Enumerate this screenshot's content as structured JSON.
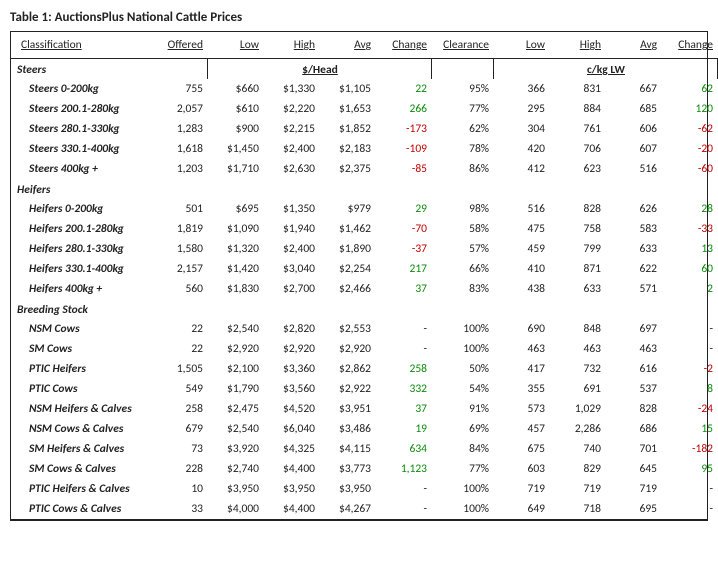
{
  "title_prefix": "Table 1:",
  "title_text": "AuctionsPlus National Cattle Prices",
  "headers": {
    "classification": "Classification",
    "offered": "Offered",
    "low": "Low",
    "high": "High",
    "avg": "Avg",
    "change": "Change",
    "clearance": "Clearance"
  },
  "units": {
    "per_head": "$/Head",
    "per_kg": "c/kg LW"
  },
  "sections": [
    {
      "name": "Steers",
      "show_units": true,
      "rows": [
        {
          "label": "Steers 0-200kg",
          "offered": "755",
          "h_low": "$660",
          "h_high": "$1,330",
          "h_avg": "$1,105",
          "h_chg": "22",
          "h_chg_sign": "pos",
          "clearance": "95%",
          "k_low": "366",
          "k_high": "831",
          "k_avg": "667",
          "k_chg": "62",
          "k_chg_sign": "pos"
        },
        {
          "label": "Steers 200.1-280kg",
          "offered": "2,057",
          "h_low": "$610",
          "h_high": "$2,220",
          "h_avg": "$1,653",
          "h_chg": "266",
          "h_chg_sign": "pos",
          "clearance": "77%",
          "k_low": "295",
          "k_high": "884",
          "k_avg": "685",
          "k_chg": "120",
          "k_chg_sign": "pos"
        },
        {
          "label": "Steers 280.1-330kg",
          "offered": "1,283",
          "h_low": "$900",
          "h_high": "$2,215",
          "h_avg": "$1,852",
          "h_chg": "-173",
          "h_chg_sign": "neg",
          "clearance": "62%",
          "k_low": "304",
          "k_high": "761",
          "k_avg": "606",
          "k_chg": "-62",
          "k_chg_sign": "neg"
        },
        {
          "label": "Steers 330.1-400kg",
          "offered": "1,618",
          "h_low": "$1,450",
          "h_high": "$2,400",
          "h_avg": "$2,183",
          "h_chg": "-109",
          "h_chg_sign": "neg",
          "clearance": "78%",
          "k_low": "420",
          "k_high": "706",
          "k_avg": "607",
          "k_chg": "-20",
          "k_chg_sign": "neg"
        },
        {
          "label": "Steers 400kg +",
          "offered": "1,203",
          "h_low": "$1,710",
          "h_high": "$2,630",
          "h_avg": "$2,375",
          "h_chg": "-85",
          "h_chg_sign": "neg",
          "clearance": "86%",
          "k_low": "412",
          "k_high": "623",
          "k_avg": "516",
          "k_chg": "-60",
          "k_chg_sign": "neg"
        }
      ]
    },
    {
      "name": "Heifers",
      "show_units": false,
      "rows": [
        {
          "label": "Heifers 0-200kg",
          "offered": "501",
          "h_low": "$695",
          "h_high": "$1,350",
          "h_avg": "$979",
          "h_chg": "29",
          "h_chg_sign": "pos",
          "clearance": "98%",
          "k_low": "516",
          "k_high": "828",
          "k_avg": "626",
          "k_chg": "28",
          "k_chg_sign": "pos"
        },
        {
          "label": "Heifers 200.1-280kg",
          "offered": "1,819",
          "h_low": "$1,090",
          "h_high": "$1,940",
          "h_avg": "$1,462",
          "h_chg": "-70",
          "h_chg_sign": "neg",
          "clearance": "58%",
          "k_low": "475",
          "k_high": "758",
          "k_avg": "583",
          "k_chg": "-33",
          "k_chg_sign": "neg"
        },
        {
          "label": "Heifers 280.1-330kg",
          "offered": "1,580",
          "h_low": "$1,320",
          "h_high": "$2,400",
          "h_avg": "$1,890",
          "h_chg": "-37",
          "h_chg_sign": "neg",
          "clearance": "57%",
          "k_low": "459",
          "k_high": "799",
          "k_avg": "633",
          "k_chg": "13",
          "k_chg_sign": "pos"
        },
        {
          "label": "Heifers 330.1-400kg",
          "offered": "2,157",
          "h_low": "$1,420",
          "h_high": "$3,040",
          "h_avg": "$2,254",
          "h_chg": "217",
          "h_chg_sign": "pos",
          "clearance": "66%",
          "k_low": "410",
          "k_high": "871",
          "k_avg": "622",
          "k_chg": "60",
          "k_chg_sign": "pos"
        },
        {
          "label": "Heifers 400kg +",
          "offered": "560",
          "h_low": "$1,830",
          "h_high": "$2,700",
          "h_avg": "$2,466",
          "h_chg": "37",
          "h_chg_sign": "pos",
          "clearance": "83%",
          "k_low": "438",
          "k_high": "633",
          "k_avg": "571",
          "k_chg": "2",
          "k_chg_sign": "pos"
        }
      ]
    },
    {
      "name": "Breeding Stock",
      "show_units": false,
      "rows": [
        {
          "label": "NSM Cows",
          "offered": "22",
          "h_low": "$2,540",
          "h_high": "$2,820",
          "h_avg": "$2,553",
          "h_chg": "-",
          "h_chg_sign": "",
          "clearance": "100%",
          "k_low": "690",
          "k_high": "848",
          "k_avg": "697",
          "k_chg": "-",
          "k_chg_sign": ""
        },
        {
          "label": "SM Cows",
          "offered": "22",
          "h_low": "$2,920",
          "h_high": "$2,920",
          "h_avg": "$2,920",
          "h_chg": "-",
          "h_chg_sign": "",
          "clearance": "100%",
          "k_low": "463",
          "k_high": "463",
          "k_avg": "463",
          "k_chg": "-",
          "k_chg_sign": ""
        },
        {
          "label": "PTIC Heifers",
          "offered": "1,505",
          "h_low": "$2,100",
          "h_high": "$3,360",
          "h_avg": "$2,862",
          "h_chg": "258",
          "h_chg_sign": "pos",
          "clearance": "50%",
          "k_low": "417",
          "k_high": "732",
          "k_avg": "616",
          "k_chg": "-2",
          "k_chg_sign": "neg"
        },
        {
          "label": "PTIC Cows",
          "offered": "549",
          "h_low": "$1,790",
          "h_high": "$3,560",
          "h_avg": "$2,922",
          "h_chg": "332",
          "h_chg_sign": "pos",
          "clearance": "54%",
          "k_low": "355",
          "k_high": "691",
          "k_avg": "537",
          "k_chg": "8",
          "k_chg_sign": "pos"
        },
        {
          "label": "NSM Heifers & Calves",
          "offered": "258",
          "h_low": "$2,475",
          "h_high": "$4,520",
          "h_avg": "$3,951",
          "h_chg": "37",
          "h_chg_sign": "pos",
          "clearance": "91%",
          "k_low": "573",
          "k_high": "1,029",
          "k_avg": "828",
          "k_chg": "-24",
          "k_chg_sign": "neg"
        },
        {
          "label": "NSM Cows & Calves",
          "offered": "679",
          "h_low": "$2,540",
          "h_high": "$6,040",
          "h_avg": "$3,486",
          "h_chg": "19",
          "h_chg_sign": "pos",
          "clearance": "69%",
          "k_low": "457",
          "k_high": "2,286",
          "k_avg": "686",
          "k_chg": "15",
          "k_chg_sign": "pos"
        },
        {
          "label": "SM Heifers & Calves",
          "offered": "73",
          "h_low": "$3,920",
          "h_high": "$4,325",
          "h_avg": "$4,115",
          "h_chg": "634",
          "h_chg_sign": "pos",
          "clearance": "84%",
          "k_low": "675",
          "k_high": "740",
          "k_avg": "701",
          "k_chg": "-182",
          "k_chg_sign": "neg"
        },
        {
          "label": "SM Cows & Calves",
          "offered": "228",
          "h_low": "$2,740",
          "h_high": "$4,400",
          "h_avg": "$3,773",
          "h_chg": "1,123",
          "h_chg_sign": "pos",
          "clearance": "77%",
          "k_low": "603",
          "k_high": "829",
          "k_avg": "645",
          "k_chg": "95",
          "k_chg_sign": "pos"
        },
        {
          "label": "PTIC Heifers & Calves",
          "offered": "10",
          "h_low": "$3,950",
          "h_high": "$3,950",
          "h_avg": "$3,950",
          "h_chg": "-",
          "h_chg_sign": "",
          "clearance": "100%",
          "k_low": "719",
          "k_high": "719",
          "k_avg": "719",
          "k_chg": "-",
          "k_chg_sign": ""
        },
        {
          "label": "PTIC Cows & Calves",
          "offered": "33",
          "h_low": "$4,000",
          "h_high": "$4,400",
          "h_avg": "$4,267",
          "h_chg": "-",
          "h_chg_sign": "",
          "clearance": "100%",
          "k_low": "649",
          "k_high": "718",
          "k_avg": "695",
          "k_chg": "-",
          "k_chg_sign": ""
        }
      ]
    }
  ]
}
